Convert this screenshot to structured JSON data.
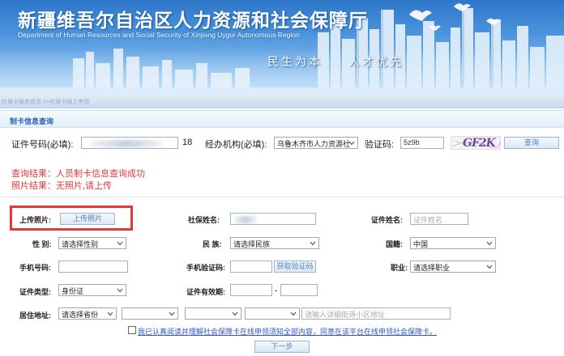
{
  "banner": {
    "title_cn": "新疆维吾尔自治区人力资源和社会保障厅",
    "title_en": "Department of Human Resources and Social Security of Xinjiang Uygur Autonomous Region",
    "slogan_1": "民生为本",
    "slogan_2": "人才优先"
  },
  "breadcrumb": "社保卡服务首页 >>社保卡线上申领",
  "section_title": "制卡信息查询",
  "query": {
    "id_label": "证件号码(必填):",
    "id_suffix": "18",
    "agency_label": "经办机构(必填):",
    "agency_value": "乌鲁木齐市人力资源社",
    "captcha_label": "验证码:",
    "captcha_value": "5z9b",
    "captcha_image_text": "GF2K",
    "query_button": "查询"
  },
  "results": {
    "line1": "查询结果：人员制卡信息查询成功",
    "line2": "照片结果：无照片,请上传"
  },
  "form": {
    "upload_label": "上传照片:",
    "upload_button": "上传照片",
    "si_name_label": "社保姓名:",
    "cert_name_label": "证件姓名:",
    "cert_name_placeholder": "证件姓名",
    "gender_label": "性 别:",
    "gender_value": "请选择性别",
    "ethnic_label": "民 族:",
    "ethnic_value": "请选择民族",
    "nationality_label": "国籍:",
    "nationality_value": "中国",
    "phone_label": "手机号码:",
    "sms_label": "手机验证码:",
    "sms_button": "获取验证码",
    "job_label": "职业:",
    "job_value": "请选择职业",
    "cert_type_label": "证件类型:",
    "cert_type_value": "身份证",
    "validity_label": "证件有效期:",
    "validity_sep": "-",
    "address_label": "居住地址:",
    "province_value": "请选择省份",
    "address_placeholder": "请输入详细街道小区地址",
    "agree_text": "我已认真阅读并理解社会保障卡在线申领须知全部内容，同意在该平台在线申领社会保障卡。",
    "next_button": "下一步"
  },
  "colors": {
    "banner_blue": "#2e76c8",
    "result_red": "#e23b3b",
    "highlight_red": "#e03a3a",
    "link_blue": "#2f56c9",
    "button_text_blue": "#4f80c0"
  },
  "icons": {
    "dropdown": "chevron-down-icon",
    "checkbox": "checkbox-icon"
  }
}
